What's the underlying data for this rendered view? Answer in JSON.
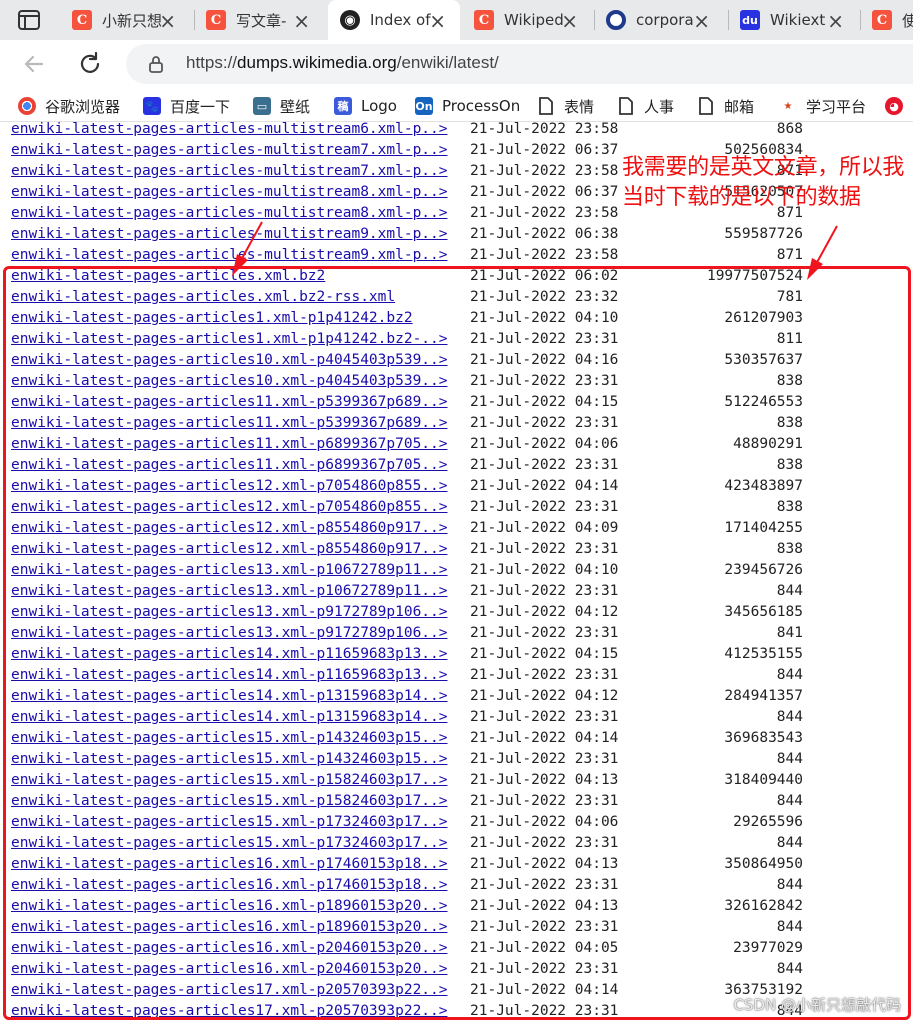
{
  "tabs": [
    {
      "title": "小新只想",
      "favicon": "csdn-icon",
      "active": false
    },
    {
      "title": "写文章-",
      "favicon": "csdn-icon",
      "active": false
    },
    {
      "title": "Index of",
      "favicon": "wikimedia-icon",
      "active": true
    },
    {
      "title": "Wikiped",
      "favicon": "csdn-icon",
      "active": false
    },
    {
      "title": "corpora",
      "favicon": "corpora-icon",
      "active": false
    },
    {
      "title": "Wikiext",
      "favicon": "baidu-icon",
      "active": false
    },
    {
      "title": "使",
      "favicon": "csdn-icon",
      "active": false
    }
  ],
  "address": {
    "prefix": "https://",
    "host": "dumps.wikimedia.org",
    "path": "/enwiki/latest/"
  },
  "bookmarks": [
    {
      "label": "谷歌浏览器",
      "icon": "chrome-icon"
    },
    {
      "label": "百度一下",
      "icon": "baidu-paw-icon"
    },
    {
      "label": "壁纸",
      "icon": "monitor-icon"
    },
    {
      "label": "Logo",
      "icon": "logo-icon"
    },
    {
      "label": "ProcessOn",
      "icon": "processon-icon"
    },
    {
      "label": "表情",
      "icon": "page-icon"
    },
    {
      "label": "人事",
      "icon": "page-icon"
    },
    {
      "label": "邮箱",
      "icon": "page-icon"
    },
    {
      "label": "学习平台",
      "icon": "star-icon"
    },
    {
      "label": "",
      "icon": "weibo-icon"
    }
  ],
  "files": [
    {
      "name": "enwiki-latest-pages-articles-multistream6.xml-p..>",
      "date": "21-Jul-2022 23:58",
      "size": "868"
    },
    {
      "name": "enwiki-latest-pages-articles-multistream7.xml-p..>",
      "date": "21-Jul-2022 06:37",
      "size": "502560834"
    },
    {
      "name": "enwiki-latest-pages-articles-multistream7.xml-p..>",
      "date": "21-Jul-2022 23:58",
      "size": "871"
    },
    {
      "name": "enwiki-latest-pages-articles-multistream8.xml-p..>",
      "date": "21-Jul-2022 06:37",
      "size": "515620507"
    },
    {
      "name": "enwiki-latest-pages-articles-multistream8.xml-p..>",
      "date": "21-Jul-2022 23:58",
      "size": "871"
    },
    {
      "name": "enwiki-latest-pages-articles-multistream9.xml-p..>",
      "date": "21-Jul-2022 06:38",
      "size": "559587726"
    },
    {
      "name": "enwiki-latest-pages-articles-multistream9.xml-p..>",
      "date": "21-Jul-2022 23:58",
      "size": "871"
    },
    {
      "name": "enwiki-latest-pages-articles.xml.bz2",
      "date": "21-Jul-2022 06:02",
      "size": "19977507524"
    },
    {
      "name": "enwiki-latest-pages-articles.xml.bz2-rss.xml",
      "date": "21-Jul-2022 23:32",
      "size": "781"
    },
    {
      "name": "enwiki-latest-pages-articles1.xml-p1p41242.bz2",
      "date": "21-Jul-2022 04:10",
      "size": "261207903"
    },
    {
      "name": "enwiki-latest-pages-articles1.xml-p1p41242.bz2-..>",
      "date": "21-Jul-2022 23:31",
      "size": "811"
    },
    {
      "name": "enwiki-latest-pages-articles10.xml-p4045403p539..>",
      "date": "21-Jul-2022 04:16",
      "size": "530357637"
    },
    {
      "name": "enwiki-latest-pages-articles10.xml-p4045403p539..>",
      "date": "21-Jul-2022 23:31",
      "size": "838"
    },
    {
      "name": "enwiki-latest-pages-articles11.xml-p5399367p689..>",
      "date": "21-Jul-2022 04:15",
      "size": "512246553"
    },
    {
      "name": "enwiki-latest-pages-articles11.xml-p5399367p689..>",
      "date": "21-Jul-2022 23:31",
      "size": "838"
    },
    {
      "name": "enwiki-latest-pages-articles11.xml-p6899367p705..>",
      "date": "21-Jul-2022 04:06",
      "size": "48890291"
    },
    {
      "name": "enwiki-latest-pages-articles11.xml-p6899367p705..>",
      "date": "21-Jul-2022 23:31",
      "size": "838"
    },
    {
      "name": "enwiki-latest-pages-articles12.xml-p7054860p855..>",
      "date": "21-Jul-2022 04:14",
      "size": "423483897"
    },
    {
      "name": "enwiki-latest-pages-articles12.xml-p7054860p855..>",
      "date": "21-Jul-2022 23:31",
      "size": "838"
    },
    {
      "name": "enwiki-latest-pages-articles12.xml-p8554860p917..>",
      "date": "21-Jul-2022 04:09",
      "size": "171404255"
    },
    {
      "name": "enwiki-latest-pages-articles12.xml-p8554860p917..>",
      "date": "21-Jul-2022 23:31",
      "size": "838"
    },
    {
      "name": "enwiki-latest-pages-articles13.xml-p10672789p11..>",
      "date": "21-Jul-2022 04:10",
      "size": "239456726"
    },
    {
      "name": "enwiki-latest-pages-articles13.xml-p10672789p11..>",
      "date": "21-Jul-2022 23:31",
      "size": "844"
    },
    {
      "name": "enwiki-latest-pages-articles13.xml-p9172789p106..>",
      "date": "21-Jul-2022 04:12",
      "size": "345656185"
    },
    {
      "name": "enwiki-latest-pages-articles13.xml-p9172789p106..>",
      "date": "21-Jul-2022 23:31",
      "size": "841"
    },
    {
      "name": "enwiki-latest-pages-articles14.xml-p11659683p13..>",
      "date": "21-Jul-2022 04:15",
      "size": "412535155"
    },
    {
      "name": "enwiki-latest-pages-articles14.xml-p11659683p13..>",
      "date": "21-Jul-2022 23:31",
      "size": "844"
    },
    {
      "name": "enwiki-latest-pages-articles14.xml-p13159683p14..>",
      "date": "21-Jul-2022 04:12",
      "size": "284941357"
    },
    {
      "name": "enwiki-latest-pages-articles14.xml-p13159683p14..>",
      "date": "21-Jul-2022 23:31",
      "size": "844"
    },
    {
      "name": "enwiki-latest-pages-articles15.xml-p14324603p15..>",
      "date": "21-Jul-2022 04:14",
      "size": "369683543"
    },
    {
      "name": "enwiki-latest-pages-articles15.xml-p14324603p15..>",
      "date": "21-Jul-2022 23:31",
      "size": "844"
    },
    {
      "name": "enwiki-latest-pages-articles15.xml-p15824603p17..>",
      "date": "21-Jul-2022 04:13",
      "size": "318409440"
    },
    {
      "name": "enwiki-latest-pages-articles15.xml-p15824603p17..>",
      "date": "21-Jul-2022 23:31",
      "size": "844"
    },
    {
      "name": "enwiki-latest-pages-articles15.xml-p17324603p17..>",
      "date": "21-Jul-2022 04:06",
      "size": "29265596"
    },
    {
      "name": "enwiki-latest-pages-articles15.xml-p17324603p17..>",
      "date": "21-Jul-2022 23:31",
      "size": "844"
    },
    {
      "name": "enwiki-latest-pages-articles16.xml-p17460153p18..>",
      "date": "21-Jul-2022 04:13",
      "size": "350864950"
    },
    {
      "name": "enwiki-latest-pages-articles16.xml-p17460153p18..>",
      "date": "21-Jul-2022 23:31",
      "size": "844"
    },
    {
      "name": "enwiki-latest-pages-articles16.xml-p18960153p20..>",
      "date": "21-Jul-2022 04:13",
      "size": "326162842"
    },
    {
      "name": "enwiki-latest-pages-articles16.xml-p18960153p20..>",
      "date": "21-Jul-2022 23:31",
      "size": "844"
    },
    {
      "name": "enwiki-latest-pages-articles16.xml-p20460153p20..>",
      "date": "21-Jul-2022 04:05",
      "size": "23977029"
    },
    {
      "name": "enwiki-latest-pages-articles16.xml-p20460153p20..>",
      "date": "21-Jul-2022 23:31",
      "size": "844"
    },
    {
      "name": "enwiki-latest-pages-articles17.xml-p20570393p22..>",
      "date": "21-Jul-2022 04:14",
      "size": "363753192"
    },
    {
      "name": "enwiki-latest-pages-articles17.xml-p20570393p22..>",
      "date": "21-Jul-2022 23:31",
      "size": "844"
    }
  ],
  "annotation": {
    "text": "我需要的是英文文章，所以我当时下载的是以下的数据",
    "color": "#ee1111"
  },
  "watermark": "CSDN @小新只想敲代码"
}
